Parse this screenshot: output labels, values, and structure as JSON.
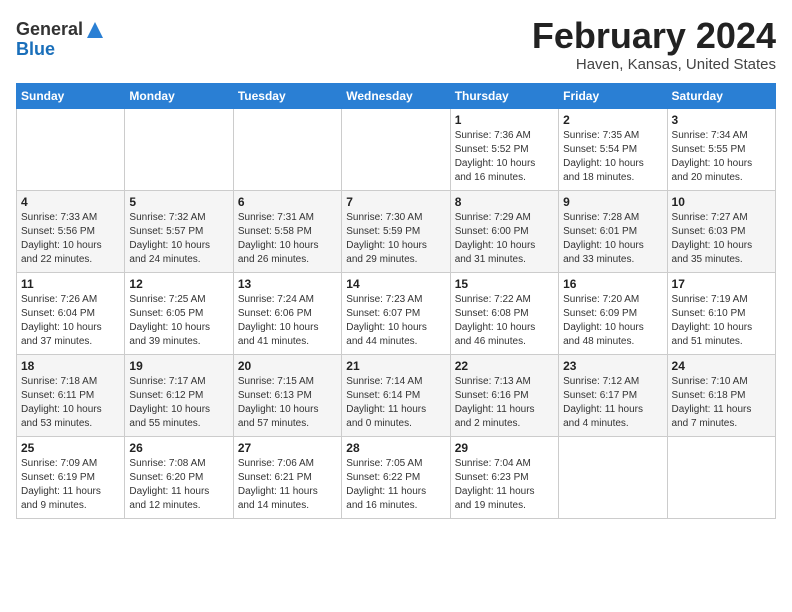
{
  "header": {
    "logo_general": "General",
    "logo_blue": "Blue",
    "main_title": "February 2024",
    "subtitle": "Haven, Kansas, United States"
  },
  "days_of_week": [
    "Sunday",
    "Monday",
    "Tuesday",
    "Wednesday",
    "Thursday",
    "Friday",
    "Saturday"
  ],
  "weeks": [
    [
      {
        "day": "",
        "content": ""
      },
      {
        "day": "",
        "content": ""
      },
      {
        "day": "",
        "content": ""
      },
      {
        "day": "",
        "content": ""
      },
      {
        "day": "1",
        "content": "Sunrise: 7:36 AM\nSunset: 5:52 PM\nDaylight: 10 hours\nand 16 minutes."
      },
      {
        "day": "2",
        "content": "Sunrise: 7:35 AM\nSunset: 5:54 PM\nDaylight: 10 hours\nand 18 minutes."
      },
      {
        "day": "3",
        "content": "Sunrise: 7:34 AM\nSunset: 5:55 PM\nDaylight: 10 hours\nand 20 minutes."
      }
    ],
    [
      {
        "day": "4",
        "content": "Sunrise: 7:33 AM\nSunset: 5:56 PM\nDaylight: 10 hours\nand 22 minutes."
      },
      {
        "day": "5",
        "content": "Sunrise: 7:32 AM\nSunset: 5:57 PM\nDaylight: 10 hours\nand 24 minutes."
      },
      {
        "day": "6",
        "content": "Sunrise: 7:31 AM\nSunset: 5:58 PM\nDaylight: 10 hours\nand 26 minutes."
      },
      {
        "day": "7",
        "content": "Sunrise: 7:30 AM\nSunset: 5:59 PM\nDaylight: 10 hours\nand 29 minutes."
      },
      {
        "day": "8",
        "content": "Sunrise: 7:29 AM\nSunset: 6:00 PM\nDaylight: 10 hours\nand 31 minutes."
      },
      {
        "day": "9",
        "content": "Sunrise: 7:28 AM\nSunset: 6:01 PM\nDaylight: 10 hours\nand 33 minutes."
      },
      {
        "day": "10",
        "content": "Sunrise: 7:27 AM\nSunset: 6:03 PM\nDaylight: 10 hours\nand 35 minutes."
      }
    ],
    [
      {
        "day": "11",
        "content": "Sunrise: 7:26 AM\nSunset: 6:04 PM\nDaylight: 10 hours\nand 37 minutes."
      },
      {
        "day": "12",
        "content": "Sunrise: 7:25 AM\nSunset: 6:05 PM\nDaylight: 10 hours\nand 39 minutes."
      },
      {
        "day": "13",
        "content": "Sunrise: 7:24 AM\nSunset: 6:06 PM\nDaylight: 10 hours\nand 41 minutes."
      },
      {
        "day": "14",
        "content": "Sunrise: 7:23 AM\nSunset: 6:07 PM\nDaylight: 10 hours\nand 44 minutes."
      },
      {
        "day": "15",
        "content": "Sunrise: 7:22 AM\nSunset: 6:08 PM\nDaylight: 10 hours\nand 46 minutes."
      },
      {
        "day": "16",
        "content": "Sunrise: 7:20 AM\nSunset: 6:09 PM\nDaylight: 10 hours\nand 48 minutes."
      },
      {
        "day": "17",
        "content": "Sunrise: 7:19 AM\nSunset: 6:10 PM\nDaylight: 10 hours\nand 51 minutes."
      }
    ],
    [
      {
        "day": "18",
        "content": "Sunrise: 7:18 AM\nSunset: 6:11 PM\nDaylight: 10 hours\nand 53 minutes."
      },
      {
        "day": "19",
        "content": "Sunrise: 7:17 AM\nSunset: 6:12 PM\nDaylight: 10 hours\nand 55 minutes."
      },
      {
        "day": "20",
        "content": "Sunrise: 7:15 AM\nSunset: 6:13 PM\nDaylight: 10 hours\nand 57 minutes."
      },
      {
        "day": "21",
        "content": "Sunrise: 7:14 AM\nSunset: 6:14 PM\nDaylight: 11 hours\nand 0 minutes."
      },
      {
        "day": "22",
        "content": "Sunrise: 7:13 AM\nSunset: 6:16 PM\nDaylight: 11 hours\nand 2 minutes."
      },
      {
        "day": "23",
        "content": "Sunrise: 7:12 AM\nSunset: 6:17 PM\nDaylight: 11 hours\nand 4 minutes."
      },
      {
        "day": "24",
        "content": "Sunrise: 7:10 AM\nSunset: 6:18 PM\nDaylight: 11 hours\nand 7 minutes."
      }
    ],
    [
      {
        "day": "25",
        "content": "Sunrise: 7:09 AM\nSunset: 6:19 PM\nDaylight: 11 hours\nand 9 minutes."
      },
      {
        "day": "26",
        "content": "Sunrise: 7:08 AM\nSunset: 6:20 PM\nDaylight: 11 hours\nand 12 minutes."
      },
      {
        "day": "27",
        "content": "Sunrise: 7:06 AM\nSunset: 6:21 PM\nDaylight: 11 hours\nand 14 minutes."
      },
      {
        "day": "28",
        "content": "Sunrise: 7:05 AM\nSunset: 6:22 PM\nDaylight: 11 hours\nand 16 minutes."
      },
      {
        "day": "29",
        "content": "Sunrise: 7:04 AM\nSunset: 6:23 PM\nDaylight: 11 hours\nand 19 minutes."
      },
      {
        "day": "",
        "content": ""
      },
      {
        "day": "",
        "content": ""
      }
    ]
  ]
}
